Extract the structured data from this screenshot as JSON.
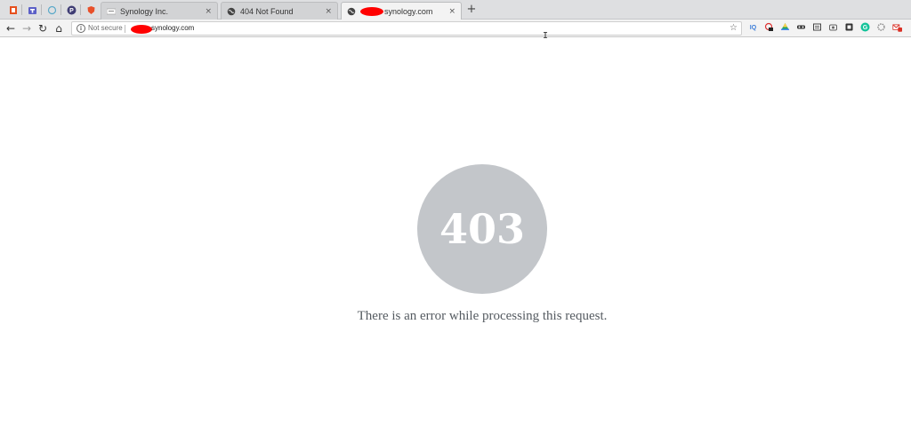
{
  "browser": {
    "tabs": [
      {
        "title": "Synology Inc.",
        "close": "×",
        "active": false
      },
      {
        "title": "404 Not Found",
        "close": "×",
        "active": false
      },
      {
        "title": "synology.com",
        "close": "×",
        "active": true
      }
    ],
    "new_tab": "+",
    "pinned_icons": [
      "office-icon",
      "teams-icon",
      "circle-icon",
      "pocket-icon",
      "shield-icon"
    ],
    "toolbar": {
      "back": "←",
      "forward": "→",
      "reload": "↻",
      "home": "⌂"
    },
    "omnibox": {
      "security_label": "Not secure",
      "url_host": "synology.com",
      "bookmark_star": "☆"
    },
    "extensions": [
      "iq-extension-icon",
      "record-extension-icon",
      "drive-extension-icon",
      "mask-extension-icon",
      "reader-extension-icon",
      "camera-extension-icon",
      "pocket-extension-icon",
      "grammarly-extension-icon",
      "gear-extension-icon",
      "gmail-extension-icon"
    ],
    "extension_labels": {
      "iq": "IQ",
      "grammarly": "G",
      "gmail": "M"
    }
  },
  "page": {
    "error_code": "403",
    "error_message": "There is an error while processing this request."
  },
  "colors": {
    "circle": "#c3c6ca",
    "message": "#555b61",
    "redaction": "#ff0000"
  }
}
